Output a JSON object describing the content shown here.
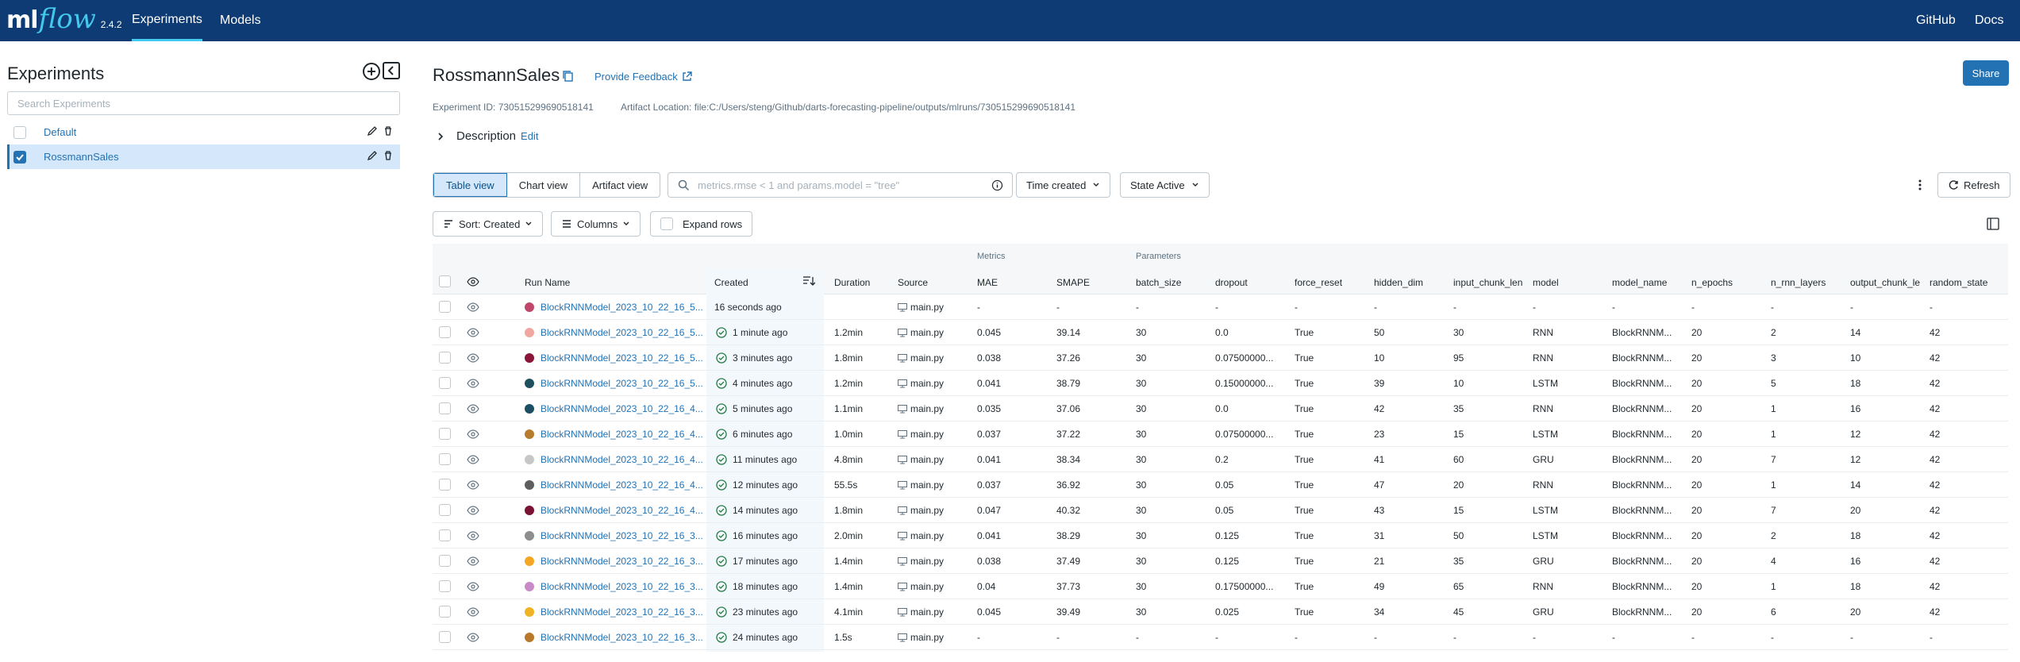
{
  "app": {
    "logo_ml": "ml",
    "logo_flow": "flow",
    "version": "2.4.2",
    "nav": [
      "Experiments",
      "Models"
    ],
    "nav_right": [
      "GitHub",
      "Docs"
    ]
  },
  "sidebar": {
    "title": "Experiments",
    "search_placeholder": "Search Experiments",
    "items": [
      {
        "label": "Default",
        "checked": false
      },
      {
        "label": "RossmannSales",
        "checked": true
      }
    ]
  },
  "header": {
    "title": "RossmannSales",
    "feedback": "Provide Feedback",
    "share": "Share",
    "experiment_id": "Experiment ID: 730515299690518141",
    "artifact_location": "Artifact Location: file:C:/Users/steng/Github/darts-forecasting-pipeline/outputs/mlruns/730515299690518141",
    "description": "Description",
    "edit": "Edit"
  },
  "toolbar": {
    "views": [
      "Table view",
      "Chart view",
      "Artifact view"
    ],
    "active_view": "Table view",
    "filter_placeholder": "metrics.rmse < 1 and params.model = \"tree\"",
    "time_created": "Time created",
    "state": "State Active",
    "refresh": "Refresh",
    "sort": "Sort: Created",
    "columns": "Columns",
    "expand_rows": "Expand rows"
  },
  "table": {
    "groups": [
      "Metrics",
      "Parameters"
    ],
    "headers": [
      "Run Name",
      "Created",
      "Duration",
      "Source",
      "MAE",
      "SMAPE",
      "batch_size",
      "dropout",
      "force_reset",
      "hidden_dim",
      "input_chunk_len",
      "model",
      "model_name",
      "n_epochs",
      "n_rnn_layers",
      "output_chunk_le",
      "random_state"
    ],
    "rows": [
      {
        "color": "#c0476a",
        "name": "BlockRNNModel_2023_10_22_16_5...",
        "done": false,
        "created": "16 seconds ago",
        "duration": "",
        "source": "main.py",
        "mae": "-",
        "smape": "-",
        "batch": "-",
        "dropout": "-",
        "force": "-",
        "hidden": "-",
        "icl": "-",
        "model": "-",
        "mname": "-",
        "epochs": "-",
        "layers": "-",
        "ocl": "-",
        "seed": "-"
      },
      {
        "color": "#f2a6a0",
        "name": "BlockRNNModel_2023_10_22_16_5...",
        "done": true,
        "created": "1 minute ago",
        "duration": "1.2min",
        "source": "main.py",
        "mae": "0.045",
        "smape": "39.14",
        "batch": "30",
        "dropout": "0.0",
        "force": "True",
        "hidden": "50",
        "icl": "30",
        "model": "RNN",
        "mname": "BlockRNNM...",
        "epochs": "20",
        "layers": "2",
        "ocl": "14",
        "seed": "42"
      },
      {
        "color": "#8a1538",
        "name": "BlockRNNModel_2023_10_22_16_5...",
        "done": true,
        "created": "3 minutes ago",
        "duration": "1.8min",
        "source": "main.py",
        "mae": "0.038",
        "smape": "37.26",
        "batch": "30",
        "dropout": "0.07500000...",
        "force": "True",
        "hidden": "10",
        "icl": "95",
        "model": "RNN",
        "mname": "BlockRNNM...",
        "epochs": "20",
        "layers": "3",
        "ocl": "10",
        "seed": "42"
      },
      {
        "color": "#1e5060",
        "name": "BlockRNNModel_2023_10_22_16_5...",
        "done": true,
        "created": "4 minutes ago",
        "duration": "1.2min",
        "source": "main.py",
        "mae": "0.041",
        "smape": "38.79",
        "batch": "30",
        "dropout": "0.15000000...",
        "force": "True",
        "hidden": "39",
        "icl": "10",
        "model": "LSTM",
        "mname": "BlockRNNM...",
        "epochs": "20",
        "layers": "5",
        "ocl": "18",
        "seed": "42"
      },
      {
        "color": "#1c4f63",
        "name": "BlockRNNModel_2023_10_22_16_4...",
        "done": true,
        "created": "5 minutes ago",
        "duration": "1.1min",
        "source": "main.py",
        "mae": "0.035",
        "smape": "37.06",
        "batch": "30",
        "dropout": "0.0",
        "force": "True",
        "hidden": "42",
        "icl": "35",
        "model": "RNN",
        "mname": "BlockRNNM...",
        "epochs": "20",
        "layers": "1",
        "ocl": "16",
        "seed": "42"
      },
      {
        "color": "#b87c2e",
        "name": "BlockRNNModel_2023_10_22_16_4...",
        "done": true,
        "created": "6 minutes ago",
        "duration": "1.0min",
        "source": "main.py",
        "mae": "0.037",
        "smape": "37.22",
        "batch": "30",
        "dropout": "0.07500000...",
        "force": "True",
        "hidden": "23",
        "icl": "15",
        "model": "LSTM",
        "mname": "BlockRNNM...",
        "epochs": "20",
        "layers": "1",
        "ocl": "12",
        "seed": "42"
      },
      {
        "color": "#c7c7c7",
        "name": "BlockRNNModel_2023_10_22_16_4...",
        "done": true,
        "created": "11 minutes ago",
        "duration": "4.8min",
        "source": "main.py",
        "mae": "0.041",
        "smape": "38.34",
        "batch": "30",
        "dropout": "0.2",
        "force": "True",
        "hidden": "41",
        "icl": "60",
        "model": "GRU",
        "mname": "BlockRNNM...",
        "epochs": "20",
        "layers": "7",
        "ocl": "12",
        "seed": "42"
      },
      {
        "color": "#5e5e5e",
        "name": "BlockRNNModel_2023_10_22_16_4...",
        "done": true,
        "created": "12 minutes ago",
        "duration": "55.5s",
        "source": "main.py",
        "mae": "0.037",
        "smape": "36.92",
        "batch": "30",
        "dropout": "0.05",
        "force": "True",
        "hidden": "47",
        "icl": "20",
        "model": "RNN",
        "mname": "BlockRNNM...",
        "epochs": "20",
        "layers": "1",
        "ocl": "14",
        "seed": "42"
      },
      {
        "color": "#7a1234",
        "name": "BlockRNNModel_2023_10_22_16_4...",
        "done": true,
        "created": "14 minutes ago",
        "duration": "1.8min",
        "source": "main.py",
        "mae": "0.047",
        "smape": "40.32",
        "batch": "30",
        "dropout": "0.05",
        "force": "True",
        "hidden": "43",
        "icl": "15",
        "model": "LSTM",
        "mname": "BlockRNNM...",
        "epochs": "20",
        "layers": "7",
        "ocl": "20",
        "seed": "42"
      },
      {
        "color": "#8e8e8e",
        "name": "BlockRNNModel_2023_10_22_16_3...",
        "done": true,
        "created": "16 minutes ago",
        "duration": "2.0min",
        "source": "main.py",
        "mae": "0.041",
        "smape": "38.29",
        "batch": "30",
        "dropout": "0.125",
        "force": "True",
        "hidden": "31",
        "icl": "50",
        "model": "LSTM",
        "mname": "BlockRNNM...",
        "epochs": "20",
        "layers": "2",
        "ocl": "18",
        "seed": "42"
      },
      {
        "color": "#f5a623",
        "name": "BlockRNNModel_2023_10_22_16_3...",
        "done": true,
        "created": "17 minutes ago",
        "duration": "1.4min",
        "source": "main.py",
        "mae": "0.038",
        "smape": "37.49",
        "batch": "30",
        "dropout": "0.125",
        "force": "True",
        "hidden": "21",
        "icl": "35",
        "model": "GRU",
        "mname": "BlockRNNM...",
        "epochs": "20",
        "layers": "4",
        "ocl": "16",
        "seed": "42"
      },
      {
        "color": "#c98bc8",
        "name": "BlockRNNModel_2023_10_22_16_3...",
        "done": true,
        "created": "18 minutes ago",
        "duration": "1.4min",
        "source": "main.py",
        "mae": "0.04",
        "smape": "37.73",
        "batch": "30",
        "dropout": "0.17500000...",
        "force": "True",
        "hidden": "49",
        "icl": "65",
        "model": "RNN",
        "mname": "BlockRNNM...",
        "epochs": "20",
        "layers": "1",
        "ocl": "18",
        "seed": "42"
      },
      {
        "color": "#f0b323",
        "name": "BlockRNNModel_2023_10_22_16_3...",
        "done": true,
        "created": "23 minutes ago",
        "duration": "4.1min",
        "source": "main.py",
        "mae": "0.045",
        "smape": "39.49",
        "batch": "30",
        "dropout": "0.025",
        "force": "True",
        "hidden": "34",
        "icl": "45",
        "model": "GRU",
        "mname": "BlockRNNM...",
        "epochs": "20",
        "layers": "6",
        "ocl": "20",
        "seed": "42"
      },
      {
        "color": "#b9782b",
        "name": "BlockRNNModel_2023_10_22_16_3...",
        "done": true,
        "created": "24 minutes ago",
        "duration": "1.5s",
        "source": "main.py",
        "mae": "-",
        "smape": "-",
        "batch": "-",
        "dropout": "-",
        "force": "-",
        "hidden": "-",
        "icl": "-",
        "model": "-",
        "mname": "-",
        "epochs": "-",
        "layers": "-",
        "ocl": "-",
        "seed": "-"
      }
    ]
  }
}
